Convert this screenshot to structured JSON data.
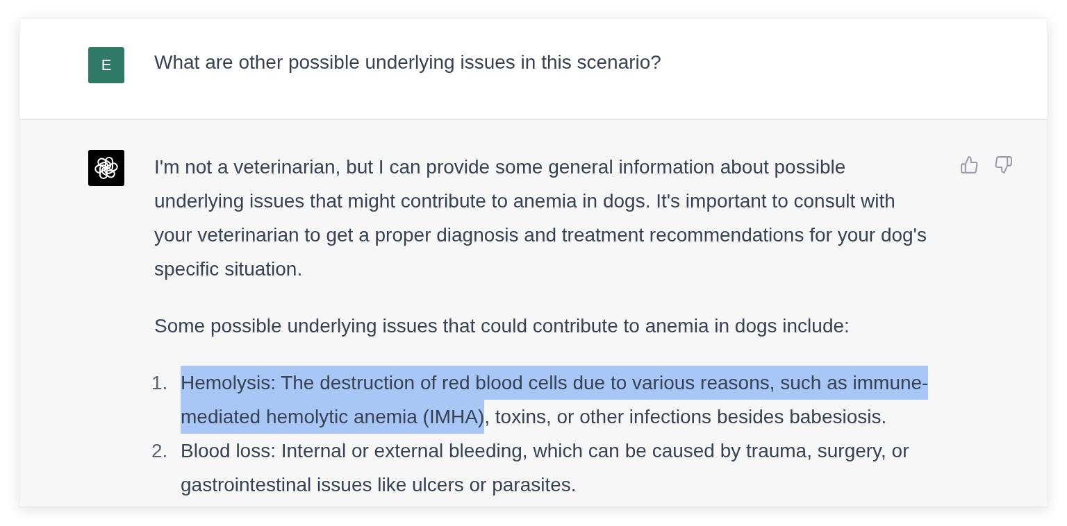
{
  "messages": [
    {
      "kind": "user",
      "avatar_letter": "E",
      "text": "What are other possible underlying issues in this scenario?"
    },
    {
      "kind": "assistant",
      "paragraphs": [
        "I'm not a veterinarian, but I can provide some general information about possible underlying issues that might contribute to anemia in dogs. It's important to consult with your veterinarian to get a proper diagnosis and treatment recommendations for your dog's specific situation.",
        "Some possible underlying issues that could contribute to anemia in dogs include:"
      ],
      "list": [
        {
          "number": "1.",
          "highlighted": "Hemolysis: The destruction of red blood cells due to various reasons, such as immune-mediated hemolytic anemia (IMHA)",
          "text": ", toxins, or other infections besides babesiosis."
        },
        {
          "number": "2.",
          "text": "Blood loss: Internal or external bleeding, which can be caused by trauma, surgery, or gastrointestinal issues like ulcers or parasites."
        }
      ]
    }
  ]
}
